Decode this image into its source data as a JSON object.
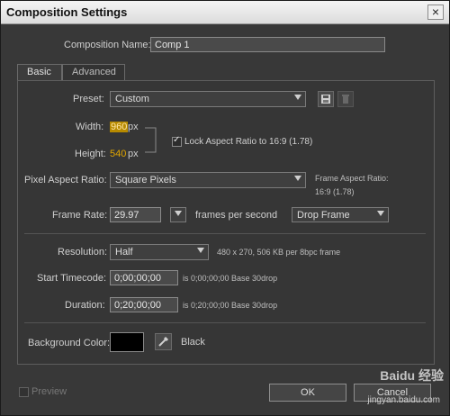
{
  "window": {
    "title": "Composition Settings",
    "close_label": "×"
  },
  "composition_name": {
    "label": "Composition Name:",
    "value": "Comp 1"
  },
  "tabs": [
    {
      "label": "Basic",
      "active": true
    },
    {
      "label": "Advanced",
      "active": false
    }
  ],
  "preset": {
    "label": "Preset:",
    "value": "Custom"
  },
  "width": {
    "label": "Width:",
    "value": "960",
    "unit": "px"
  },
  "height": {
    "label": "Height:",
    "value": "540",
    "unit": "px"
  },
  "lock_aspect": {
    "label": "Lock Aspect Ratio to 16:9 (1.78)",
    "checked": true
  },
  "pixel_aspect": {
    "label": "Pixel Aspect Ratio:",
    "value": "Square Pixels"
  },
  "frame_aspect": {
    "label": "Frame Aspect Ratio:",
    "value": "16:9 (1.78)"
  },
  "frame_rate": {
    "label": "Frame Rate:",
    "value": "29.97",
    "unit_label": "frames per second",
    "drop_frame": "Drop Frame"
  },
  "resolution": {
    "label": "Resolution:",
    "value": "Half",
    "info": "480 x 270, 506 KB per 8bpc frame"
  },
  "start_timecode": {
    "label": "Start Timecode:",
    "value": "0;00;00;00",
    "info": "is 0;00;00;00  Base 30drop"
  },
  "duration": {
    "label": "Duration:",
    "value": "0;20;00;00",
    "info": "is 0;20;00;00  Base 30drop"
  },
  "background": {
    "label": "Background Color:",
    "color": "#000000",
    "name": "Black"
  },
  "footer": {
    "preview_label": "Preview",
    "ok_label": "OK",
    "cancel_label": "Cancel"
  },
  "watermark": {
    "text": "Baidu 经验",
    "url": "jingyan.baidu.com"
  },
  "colors": {
    "accent_orange": "#e0a500",
    "dialog_bg": "#383838"
  }
}
